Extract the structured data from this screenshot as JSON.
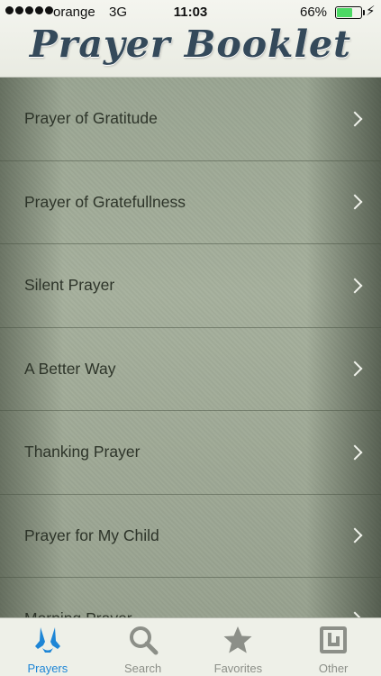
{
  "status_bar": {
    "carrier": "orange",
    "network": "3G",
    "time": "11:03",
    "battery_percent": "66%",
    "battery_level": 0.66,
    "bolt": "⚡"
  },
  "header": {
    "title": "Prayer Booklet"
  },
  "prayers": [
    {
      "label": "Prayer of Gratitude"
    },
    {
      "label": "Prayer of Gratefullness"
    },
    {
      "label": "Silent Prayer"
    },
    {
      "label": "A Better Way"
    },
    {
      "label": "Thanking Prayer"
    },
    {
      "label": "Prayer for My Child"
    },
    {
      "label": "Morning Prayer"
    }
  ],
  "tabs": [
    {
      "label": "Prayers",
      "icon": "praying-hands-icon",
      "active": true
    },
    {
      "label": "Search",
      "icon": "search-icon",
      "active": false
    },
    {
      "label": "Favorites",
      "icon": "star-icon",
      "active": false
    },
    {
      "label": "Other",
      "icon": "other-app-icon",
      "active": false
    }
  ],
  "colors": {
    "accent": "#1e86d6",
    "title": "#34495a",
    "battery": "#4cd964"
  }
}
